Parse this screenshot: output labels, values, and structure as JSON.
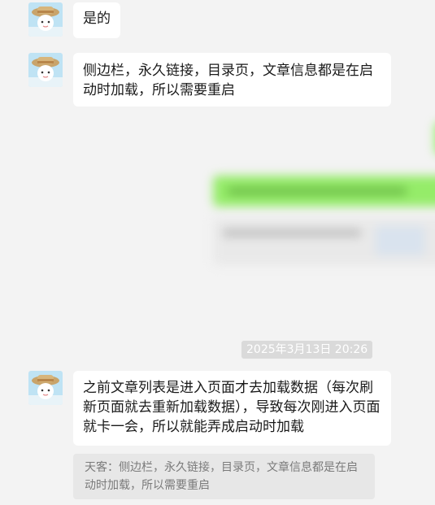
{
  "messages": [
    {
      "sender": "contact",
      "text": "是的"
    },
    {
      "sender": "contact",
      "text": "侧边栏，永久链接，目录页，文章信息都是在启动时加载，所以需要重启"
    },
    {
      "sender": "contact",
      "text": "之前文章列表是进入页面才去加载数据（每次刷新页面就去重新加载数据），导致每次刚进入页面就卡一会，所以就能弄成启动时加载"
    }
  ],
  "timestamp": "2025年3月13日 20:26",
  "quote": {
    "author": "天客",
    "text": "天客：侧边栏，永久链接，目录页，文章信息都是在启动时加载，所以需要重启"
  },
  "colors": {
    "background": "#f3f3f3",
    "incoming_bubble": "#ffffff",
    "outgoing_bubble": "#95ec69"
  }
}
